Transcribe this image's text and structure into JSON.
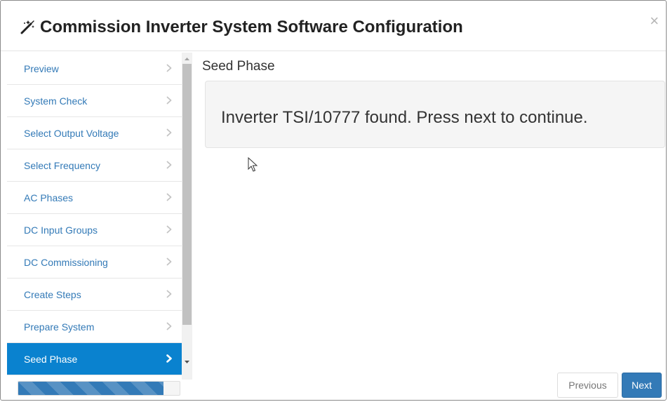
{
  "dialog": {
    "title": "Commission Inverter System Software Configuration",
    "close_symbol": "×",
    "title_icon": "magic-wand-icon"
  },
  "sidebar": {
    "items": [
      {
        "label": "Preview"
      },
      {
        "label": "System Check"
      },
      {
        "label": "Select Output Voltage"
      },
      {
        "label": "Select Frequency"
      },
      {
        "label": "AC Phases"
      },
      {
        "label": "DC Input Groups"
      },
      {
        "label": "DC Commissioning"
      },
      {
        "label": "Create Steps"
      },
      {
        "label": "Prepare System"
      },
      {
        "label": "Seed Phase",
        "active": true
      }
    ],
    "progress_fraction": 0.9
  },
  "main": {
    "panel_title": "Seed Phase",
    "message": "Inverter TSI/10777 found. Press next to continue."
  },
  "footer": {
    "previous_label": "Previous",
    "next_label": "Next"
  },
  "colors": {
    "accent": "#0a82cf",
    "link": "#337ab7",
    "primary_button": "#337ab7"
  }
}
